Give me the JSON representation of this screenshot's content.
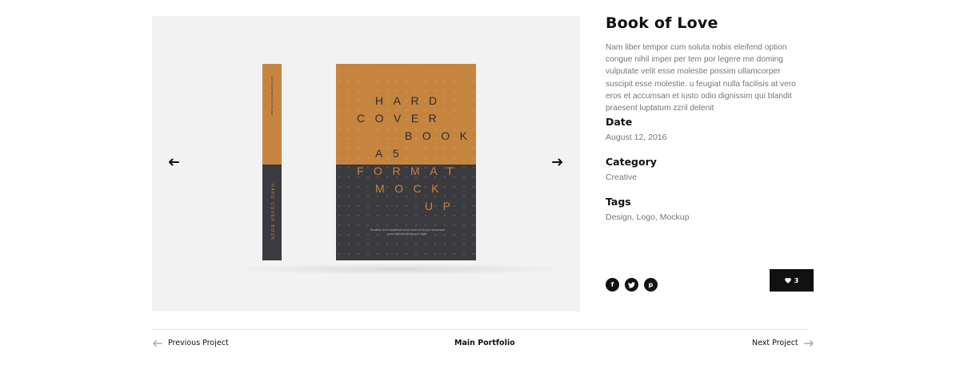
{
  "gallery": {
    "spine": {
      "title": "HARD COVER BOOK",
      "small_text": "A5 Format Hard Cover Mockup"
    },
    "cover": {
      "lines": [
        "HARD",
        "COVER",
        "BOOK",
        "A5",
        "FORMAT",
        "MOCK",
        "UP"
      ],
      "blurb": "Realistic and handbook book cover to let you showcase your editorial designs in style."
    },
    "prev_icon": "arrow-left-icon",
    "next_icon": "arrow-right-icon",
    "colors": {
      "cover_top": "#c6853f",
      "cover_bottom": "#3b3a3f",
      "background": "#f2f2f2"
    }
  },
  "project": {
    "title": "Book of Love",
    "description": "Nam liber tempor cum soluta nobis eleifend option congue nihil imper per tem por legere me doming vulputate velit esse molestie possim ullamcorper suscipit esse molestie. u feugiat nulla facilisis at vero eros et accumsan et iusto odio dignissim qui blandit praesent luptatum zzril delenit",
    "date_label": "Date",
    "date_value": "August 12, 2016",
    "category_label": "Category",
    "category_value": "Creative",
    "tags_label": "Tags",
    "tags_value": "Design, Logo, Mockup"
  },
  "social": {
    "facebook": "f",
    "twitter": "twitter-bird-icon",
    "pinterest": "p"
  },
  "like": {
    "icon": "heart-icon",
    "count": "3"
  },
  "footer_nav": {
    "previous": "Previous Project",
    "main": "Main Portfolio",
    "next": "Next Project"
  }
}
